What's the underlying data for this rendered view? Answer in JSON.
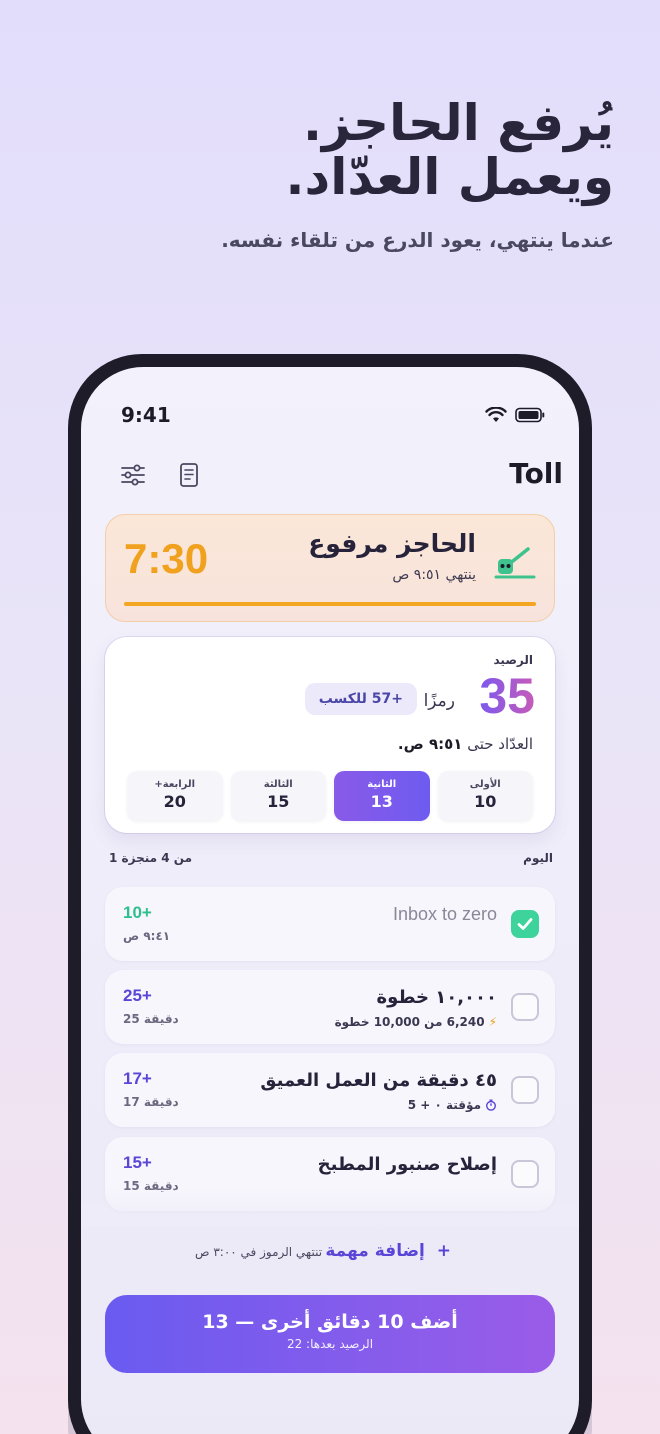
{
  "marketing": {
    "headline_line1": "يُرفع الحاجز.",
    "headline_line2": "ويعمل العدّاد.",
    "subtitle": "عندما ينتهي، يعود الدرع من تلقاء نفسه."
  },
  "status_bar": {
    "time": "9:41"
  },
  "app": {
    "title": "Toll"
  },
  "icons": {
    "settings": "sliders-icon",
    "log": "document-icon",
    "gate": "raised-barrier-icon",
    "wifi": "wifi-icon",
    "battery": "battery-icon"
  },
  "barrier": {
    "title": "الحاجز مرفوع",
    "ends": "ينتهي ٩:٥١ ص",
    "timer": "7:30",
    "progress": 1.0,
    "accent": "#f3a621"
  },
  "balance": {
    "label": "الرصيد",
    "value": "35",
    "unit": "رمزًا",
    "earn": "+57 للكسب",
    "until_prefix": "العدّاد حتى",
    "until_time": "٩:٥١ ص."
  },
  "tiers": [
    {
      "name": "الأولى",
      "value": "10",
      "active": false
    },
    {
      "name": "الثانية",
      "value": "13",
      "active": true
    },
    {
      "name": "الثالثة",
      "value": "15",
      "active": false
    },
    {
      "name": "الرابعة+",
      "value": "20",
      "active": false
    }
  ],
  "day": {
    "label": "اليوم",
    "progress": "1 من 4 منجزة"
  },
  "tasks": [
    {
      "name": "Inbox to zero",
      "points": "10+",
      "sub": "٩:٤١ ص",
      "done": true
    },
    {
      "name": "١٠,٠٠٠ خطوة",
      "points": "25+",
      "sub": "25 دقيقة",
      "meta": "6,240 من 10,000 خطوة",
      "meta_icon": "bolt-icon",
      "done": false
    },
    {
      "name": "٤٥ دقيقة من العمل العميق",
      "points": "17+",
      "sub": "17 دقيقة",
      "meta": "مؤقتة ٠ + 5",
      "meta_icon": "timer-icon",
      "done": false
    },
    {
      "name": "إصلاح صنبور المطبخ",
      "points": "15+",
      "sub": "15 دقيقة",
      "done": false
    }
  ],
  "add_task": {
    "label": "إضافة مهمة",
    "plus": "+",
    "expiry": "تنتهي الرموز في ٣:٠٠ ص"
  },
  "cta": {
    "main": "أضف 10 دقائق أخرى — 13",
    "after": "الرصيد بعدها: 22"
  },
  "colors": {
    "accent": "#6a5bf0",
    "done": "#3fd39c",
    "warning": "#f0a21e"
  }
}
